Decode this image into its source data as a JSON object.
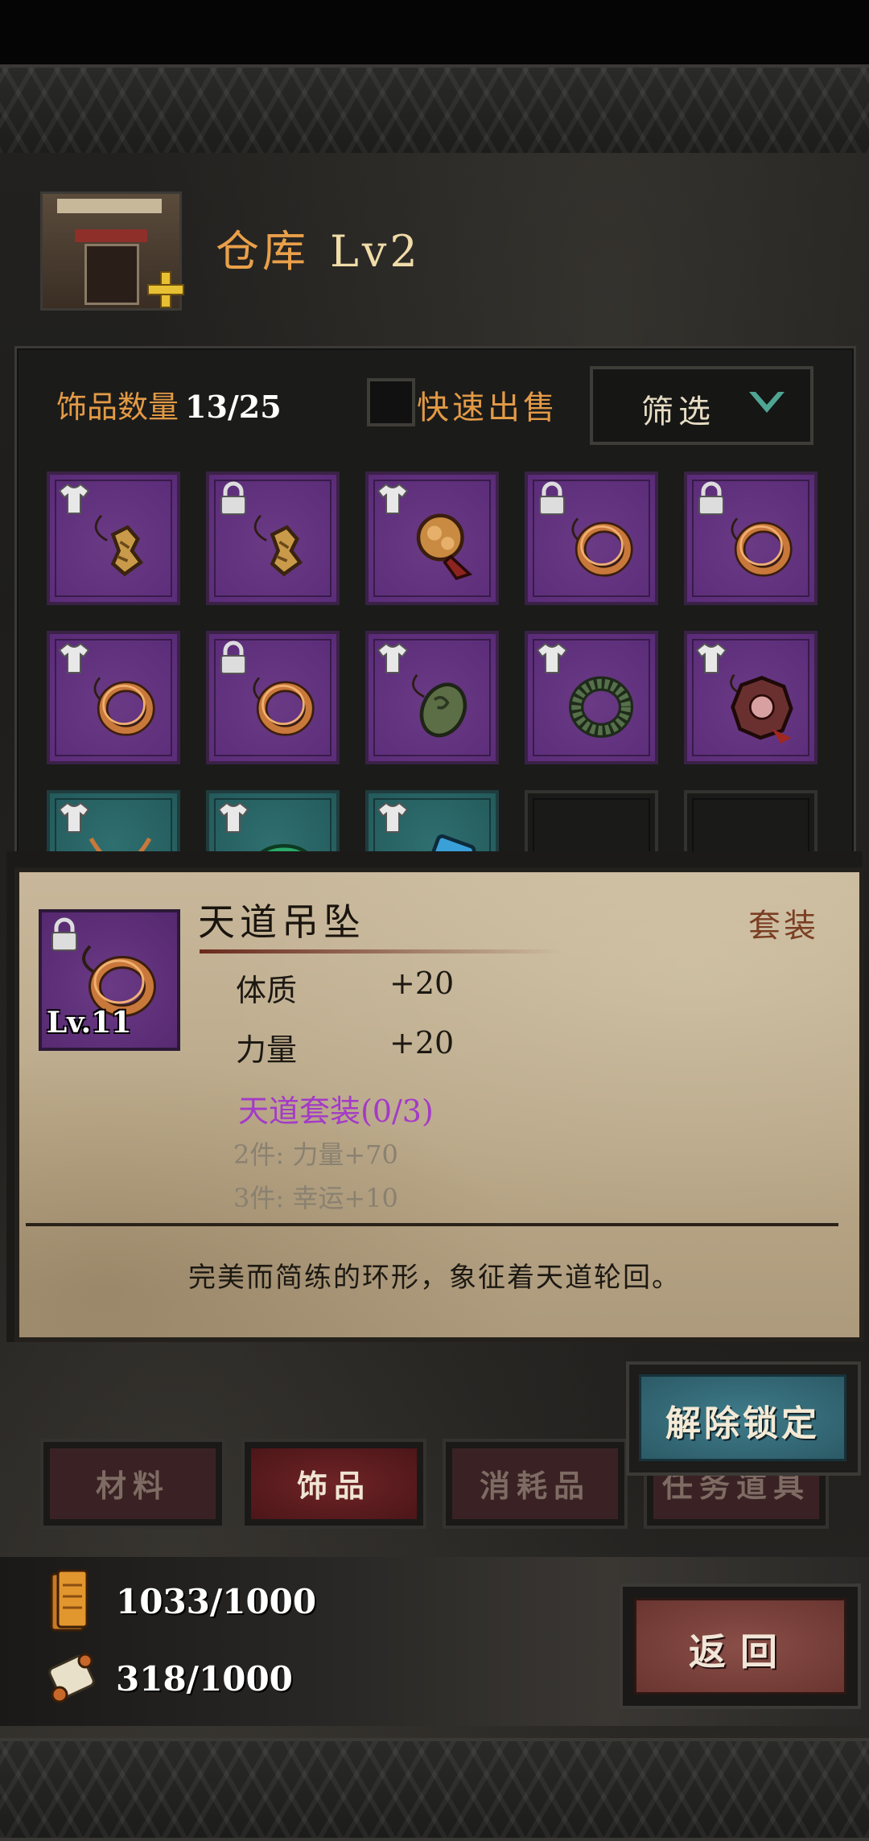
{
  "warehouse": {
    "title": "仓库",
    "level": "Lv2"
  },
  "inventory": {
    "count_label": "饰品数量",
    "count_value": "13/25",
    "quick_sell_label": "快速出售",
    "filter_label": "筛选"
  },
  "slots": [
    {
      "rarity": "purple",
      "badge": "shirt",
      "item": "dragon-pendant"
    },
    {
      "rarity": "purple",
      "badge": "lock",
      "item": "dragon-pendant"
    },
    {
      "rarity": "purple",
      "badge": "shirt",
      "item": "gold-charm"
    },
    {
      "rarity": "purple",
      "badge": "lock",
      "item": "bronze-ring"
    },
    {
      "rarity": "purple",
      "badge": "lock",
      "item": "bronze-ring"
    },
    {
      "rarity": "purple",
      "badge": "shirt",
      "item": "bronze-ring"
    },
    {
      "rarity": "purple",
      "badge": "lock",
      "item": "bronze-ring"
    },
    {
      "rarity": "purple",
      "badge": "shirt",
      "item": "jade-pendant"
    },
    {
      "rarity": "purple",
      "badge": "shirt",
      "item": "jade-ring"
    },
    {
      "rarity": "purple",
      "badge": "shirt",
      "item": "bagua-charm"
    },
    {
      "rarity": "teal",
      "badge": "shirt",
      "item": "necklace"
    },
    {
      "rarity": "teal",
      "badge": "shirt",
      "item": "tap-bracelet"
    },
    {
      "rarity": "teal",
      "badge": "shirt",
      "item": "tap-card"
    },
    {
      "rarity": "empty",
      "badge": "",
      "item": ""
    },
    {
      "rarity": "empty",
      "badge": "",
      "item": ""
    }
  ],
  "tooltip": {
    "name": "天道吊坠",
    "tag": "套装",
    "level": "Lv.11",
    "stats": [
      {
        "name": "体质",
        "value": "+20"
      },
      {
        "name": "力量",
        "value": "+20"
      }
    ],
    "set_title": "天道套装(0/3)",
    "set_bonuses": [
      "2件: 力量+70",
      "3件: 幸运+10"
    ],
    "description": "完美而简练的环形，象征着天道轮回。"
  },
  "unlock_button": "解除锁定",
  "tabs": [
    {
      "label": "材料",
      "active": false
    },
    {
      "label": "饰品",
      "active": true
    },
    {
      "label": "消耗品",
      "active": false
    },
    {
      "label": "任务道具",
      "active": false
    }
  ],
  "resources": [
    {
      "icon": "scroll-bundle-icon",
      "value": "1033/1000"
    },
    {
      "icon": "paper-roll-icon",
      "value": "318/1000"
    }
  ],
  "back_button": "返回",
  "colors": {
    "accent_orange": "#e39a45",
    "epic_purple": "#5a2b78",
    "set_purple": "#a43ac8",
    "unlock_teal": "#3f7c8b",
    "back_red": "#8a4e48"
  }
}
